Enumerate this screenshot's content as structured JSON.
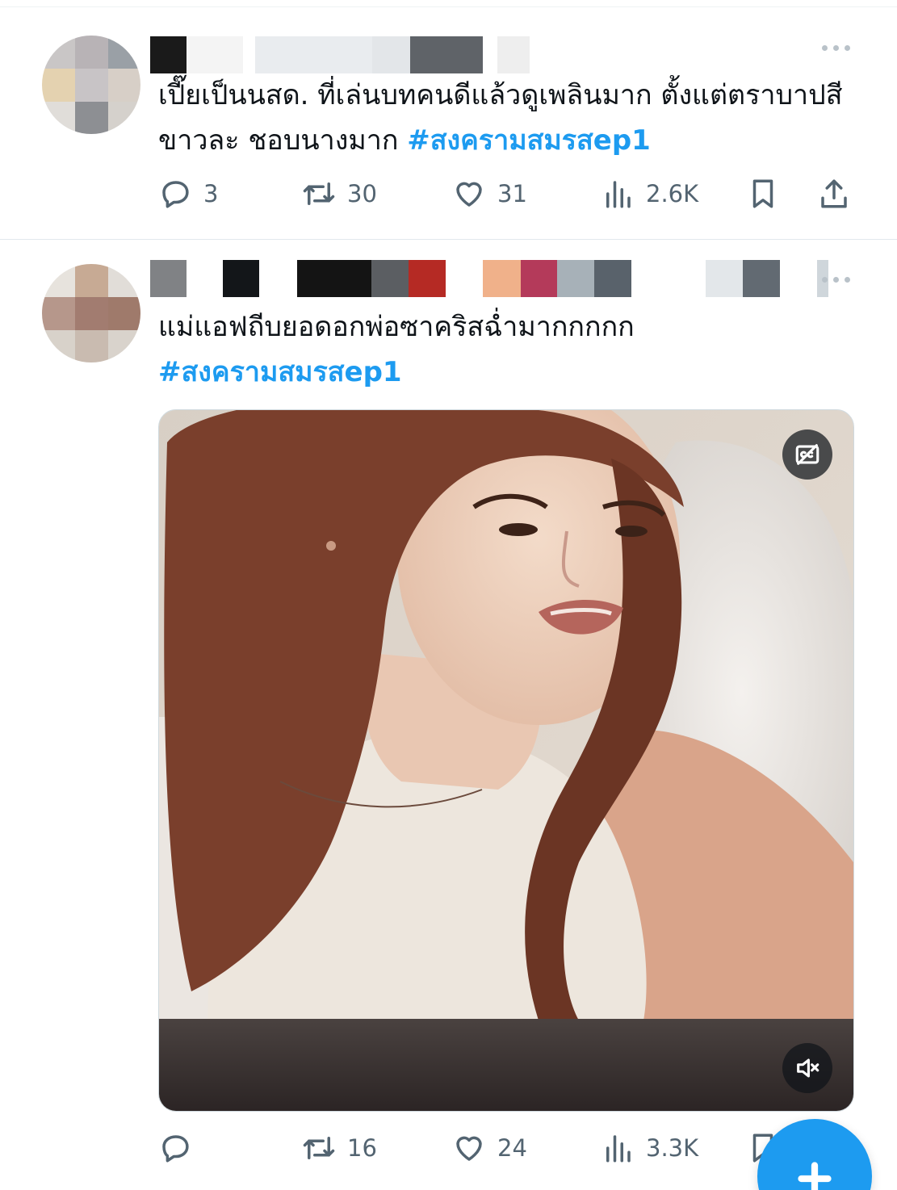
{
  "colors": {
    "accent": "#1d9bf0",
    "text": "#0f1419",
    "muted": "#536471",
    "divider": "#e1e8ed"
  },
  "tweets": [
    {
      "text": "เปี๊ยเป็นนสด. ที่เล่นบทคนดีแล้วดูเพลินมาก ตั้งแต่ตราบาปสีขาวละ ชอบนางมาก",
      "hashtag": "#สงครามสมรสep1",
      "stats": {
        "replies": "3",
        "retweets": "30",
        "likes": "31",
        "views": "2.6K"
      }
    },
    {
      "text": "แม่แอฟถีบยอดอกพ่อซาคริสฉ่ำมากกกกก",
      "hashtag": "#สงครามสมรสep1",
      "stats": {
        "replies": "",
        "retweets": "16",
        "likes": "24",
        "views": "3.3K"
      },
      "media": {
        "type": "video",
        "muted": true,
        "captions_available": true
      }
    }
  ],
  "icons": [
    "more-icon",
    "reply-icon",
    "retweet-icon",
    "like-icon",
    "views-icon",
    "bookmark-icon",
    "share-icon",
    "captions-icon",
    "mute-icon",
    "compose-plus-icon"
  ]
}
